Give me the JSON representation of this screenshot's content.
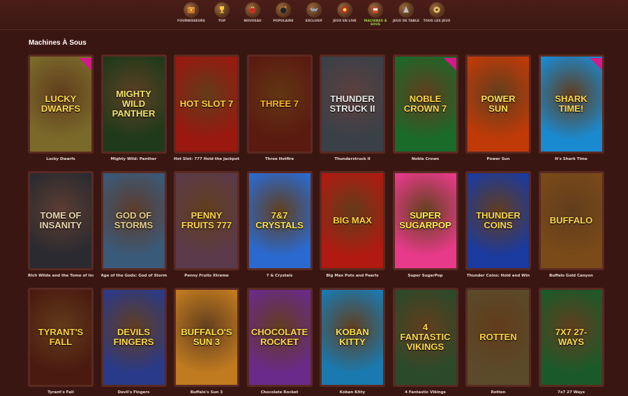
{
  "nav": [
    {
      "label": "Fournisseurs",
      "icon": "chest-icon",
      "active": false
    },
    {
      "label": "Top",
      "icon": "trophy-icon",
      "active": false
    },
    {
      "label": "Nouveau",
      "icon": "bag-icon",
      "active": false
    },
    {
      "label": "Populaire",
      "icon": "bomb-icon",
      "active": false
    },
    {
      "label": "Exclusif",
      "icon": "helmet-icon",
      "active": false
    },
    {
      "label": "Jeux en live",
      "icon": "roulette-icon",
      "active": false
    },
    {
      "label": "Machines à sous",
      "icon": "slot-machine-icon",
      "active": true
    },
    {
      "label": "Jeux de table",
      "icon": "card-table-icon",
      "active": false
    },
    {
      "label": "Tous les jeux",
      "icon": "dice-icon",
      "active": false
    }
  ],
  "section": {
    "title": "Machines À Sous"
  },
  "games": [
    {
      "name": "Lucky Dwarfs",
      "art": "LUCKY DWARFS",
      "bg": "#7a6a2a",
      "fg": "#ffd84a",
      "badge": true
    },
    {
      "name": "Mighty Wild: Panther",
      "art": "MIGHTY WILD PANTHER",
      "bg": "#1e3a1a",
      "fg": "#f4e36a",
      "badge": false
    },
    {
      "name": "Hot Slot: 777 Hold the Jackpot",
      "art": "HOT SLOT 7",
      "bg": "#9a1810",
      "fg": "#ffd23a",
      "badge": false
    },
    {
      "name": "Three Hotfire",
      "art": "THREE 7",
      "bg": "#5a1a10",
      "fg": "#ffb41a",
      "badge": false
    },
    {
      "name": "Thunderstruck II",
      "art": "THUNDER STRUCK II",
      "bg": "#3a4048",
      "fg": "#e8e8e8",
      "badge": false
    },
    {
      "name": "Noble Crown",
      "art": "NOBLE CROWN 7",
      "bg": "#1a6a2a",
      "fg": "#ffd84a",
      "badge": true
    },
    {
      "name": "Power Sun",
      "art": "POWER SUN",
      "bg": "#c03a08",
      "fg": "#ffe04a",
      "badge": false
    },
    {
      "name": "It's Shark Time",
      "art": "SHARK TIME!",
      "bg": "#1a8ad0",
      "fg": "#ffd84a",
      "badge": true
    },
    {
      "name": "Rich Wilde and the Tome of Insanity",
      "art": "TOME OF INSANITY",
      "bg": "#2a2a30",
      "fg": "#e8d8b0",
      "badge": false
    },
    {
      "name": "Age of the Gods: God of Storms Fir...",
      "art": "GOD OF STORMS",
      "bg": "#3a5a7a",
      "fg": "#e8d088",
      "badge": false
    },
    {
      "name": "Penny Fruits Xtreme",
      "art": "PENNY FRUITS 777",
      "bg": "#5a3a4a",
      "fg": "#ffd84a",
      "badge": false
    },
    {
      "name": "7 & Crystals",
      "art": "7&7 CRYSTALS",
      "bg": "#2a6ad0",
      "fg": "#ffe04a",
      "badge": false
    },
    {
      "name": "Big Max Pots and Pearls",
      "art": "BIG MAX",
      "bg": "#b01a10",
      "fg": "#ffd23a",
      "badge": false
    },
    {
      "name": "Super SugarPop",
      "art": "SUPER SUGARPOP",
      "bg": "#e83a8a",
      "fg": "#fff04a",
      "badge": false
    },
    {
      "name": "Thunder Coins: Hold and Win",
      "art": "THUNDER COINS",
      "bg": "#1a3aa0",
      "fg": "#ffd84a",
      "badge": false
    },
    {
      "name": "Buffalo Gold Canyon",
      "art": "BUFFALO",
      "bg": "#7a4a18",
      "fg": "#ffd84a",
      "badge": false
    },
    {
      "name": "Tyrant's Fall",
      "art": "TYRANT'S FALL",
      "bg": "#4a1a10",
      "fg": "#ffd23a",
      "badge": false
    },
    {
      "name": "Devil's Fingers",
      "art": "DEVILS FINGERS",
      "bg": "#2a3a8a",
      "fg": "#ffd84a",
      "badge": false
    },
    {
      "name": "Buffalo's Sun 3",
      "art": "BUFFALO'S SUN 3",
      "bg": "#c07a20",
      "fg": "#ffe04a",
      "badge": false
    },
    {
      "name": "Chocolate Rocket",
      "art": "CHOCOLATE ROCKET",
      "bg": "#6a2a8a",
      "fg": "#ffd84a",
      "badge": false
    },
    {
      "name": "Koban Kitty",
      "art": "KOBAN KITTY",
      "bg": "#1a7ab0",
      "fg": "#ffe04a",
      "badge": false
    },
    {
      "name": "4 Fantastic Vikings",
      "art": "4 FANTASTIC VIKINGS",
      "bg": "#2a4a2a",
      "fg": "#ffd84a",
      "badge": false
    },
    {
      "name": "Rotten",
      "art": "ROTTEN",
      "bg": "#5a4a2a",
      "fg": "#ffd23a",
      "badge": false
    },
    {
      "name": "7x7 27 Ways",
      "art": "7X7 27-WAYS",
      "bg": "#1a5a2a",
      "fg": "#ffd84a",
      "badge": false
    }
  ]
}
